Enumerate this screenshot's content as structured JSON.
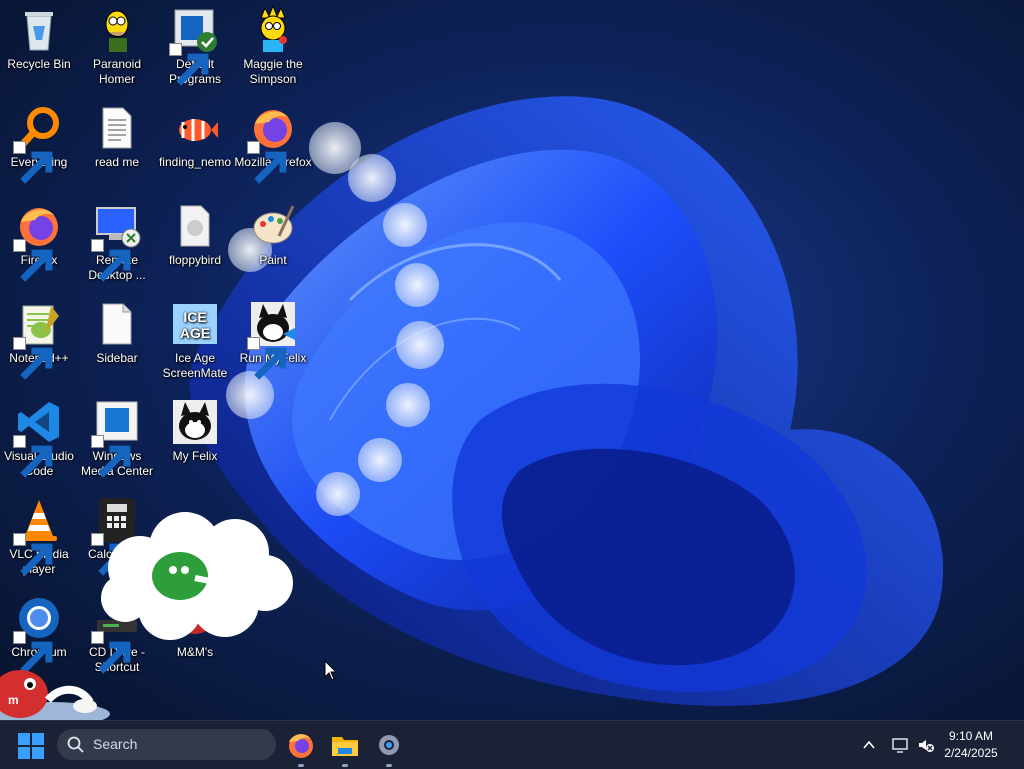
{
  "desktop": {
    "icons": [
      {
        "label": "Recycle Bin"
      },
      {
        "label": "Paranoid Homer"
      },
      {
        "label": "Default Programs"
      },
      {
        "label": "Maggie the Simpson"
      },
      {
        "label": "Everything"
      },
      {
        "label": "read me"
      },
      {
        "label": "finding_nemo"
      },
      {
        "label": "Mozilla Firefox"
      },
      {
        "label": "Firefox"
      },
      {
        "label": "Remote Desktop ..."
      },
      {
        "label": "floppybird"
      },
      {
        "label": "Paint"
      },
      {
        "label": "Notepad++"
      },
      {
        "label": "Sidebar"
      },
      {
        "label": "Ice Age ScreenMate"
      },
      {
        "label": "Run MyFelix"
      },
      {
        "label": "Visual Studio Code"
      },
      {
        "label": "Windows Media Center"
      },
      {
        "label": "My Felix"
      },
      {
        "label": "VLC media player"
      },
      {
        "label": "Calculator"
      },
      {
        "label": "Chromium"
      },
      {
        "label": "CD Drive - Shortcut"
      },
      {
        "label": "M&M's"
      }
    ]
  },
  "taskbar": {
    "search_placeholder": "Search",
    "pinned_apps": [
      "firefox-icon",
      "file-explorer-icon",
      "settings-icon"
    ],
    "tray": {
      "time": "9:10 AM",
      "date": "2/24/2025"
    }
  },
  "colors": {
    "taskbar": "#1c2236",
    "wallpaper_accent": "#1e4cff"
  }
}
